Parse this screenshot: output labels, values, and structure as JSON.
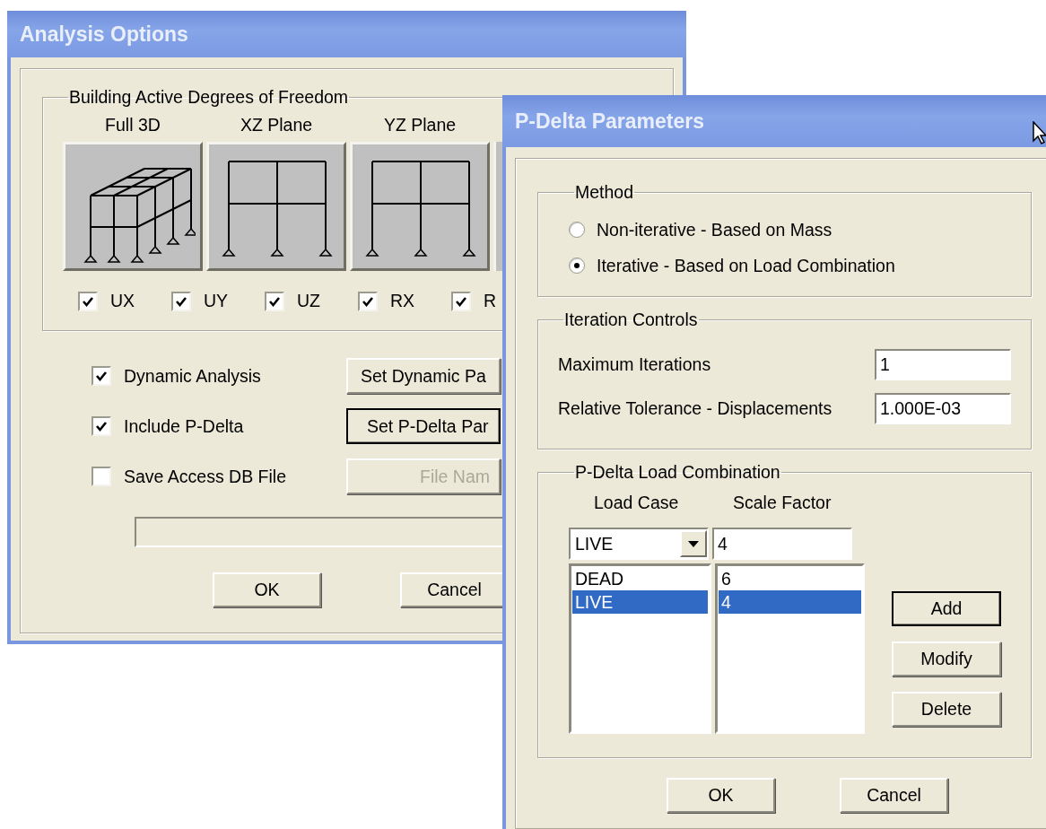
{
  "analysis_options": {
    "title": "Analysis Options",
    "dof_group": {
      "label": "Building Active Degrees of Freedom",
      "presets": [
        {
          "label": "Full 3D",
          "kind": "isometric"
        },
        {
          "label": "XZ Plane",
          "kind": "plane"
        },
        {
          "label": "YZ Plane",
          "kind": "plane"
        }
      ],
      "dofs": [
        {
          "label": "UX",
          "checked": true
        },
        {
          "label": "UY",
          "checked": true
        },
        {
          "label": "UZ",
          "checked": true
        },
        {
          "label": "RX",
          "checked": true
        },
        {
          "label": "R",
          "checked": true
        }
      ]
    },
    "options": [
      {
        "label": "Dynamic Analysis",
        "checked": true,
        "button": "Set Dynamic Pa",
        "default": false,
        "disabled": false
      },
      {
        "label": "Include P-Delta",
        "checked": true,
        "button": "Set P-Delta Par",
        "default": true,
        "disabled": false
      },
      {
        "label": "Save Access DB File",
        "checked": false,
        "button": "File Nam",
        "default": false,
        "disabled": true
      }
    ],
    "buttons": [
      "OK",
      "Cancel"
    ]
  },
  "p_delta": {
    "title": "P-Delta Parameters",
    "method": {
      "label": "Method",
      "options": [
        {
          "label": "Non-iterative - Based on Mass",
          "selected": false
        },
        {
          "label": "Iterative - Based on Load Combination",
          "selected": true
        }
      ]
    },
    "iteration": {
      "label": "Iteration Controls",
      "fields": [
        {
          "label": "Maximum Iterations",
          "value": "1"
        },
        {
          "label": "Relative Tolerance - Displacements",
          "value": "1.000E-03"
        }
      ]
    },
    "load_combination": {
      "label": "P-Delta Load Combination",
      "columns": [
        "Load Case",
        "Scale Factor"
      ],
      "load_case_value": "LIVE",
      "scale_factor_value": "4",
      "rows": [
        {
          "load_case": "DEAD",
          "scale_factor": "6",
          "selected": false
        },
        {
          "load_case": "LIVE",
          "scale_factor": "4",
          "selected": true
        }
      ],
      "buttons": [
        {
          "label": "Add",
          "default": true
        },
        {
          "label": "Modify",
          "default": false
        },
        {
          "label": "Delete",
          "default": false
        }
      ]
    },
    "buttons": [
      "OK",
      "Cancel"
    ]
  }
}
